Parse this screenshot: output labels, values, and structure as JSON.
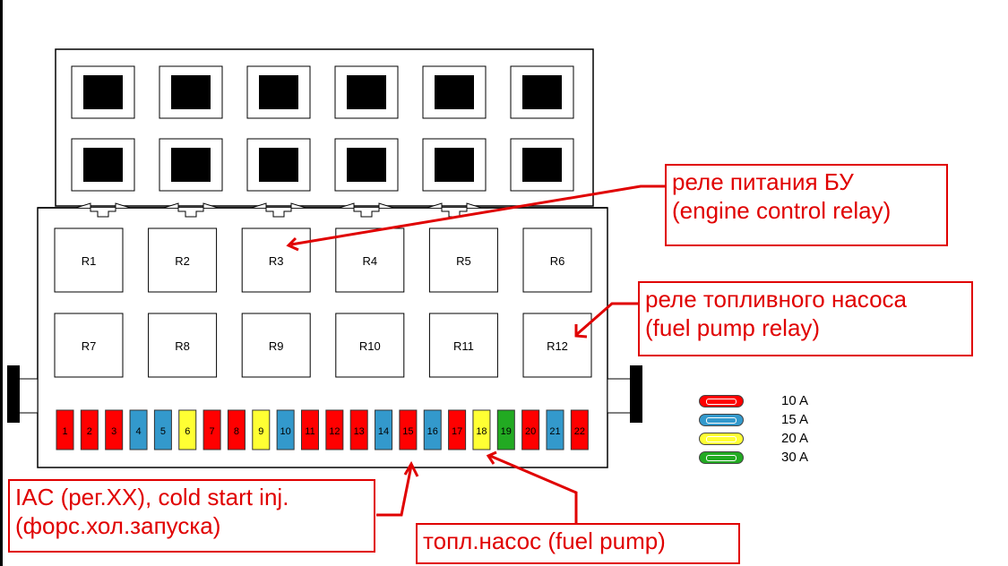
{
  "relays": [
    {
      "label": "R1"
    },
    {
      "label": "R2"
    },
    {
      "label": "R3"
    },
    {
      "label": "R4"
    },
    {
      "label": "R5"
    },
    {
      "label": "R6"
    },
    {
      "label": "R7"
    },
    {
      "label": "R8"
    },
    {
      "label": "R9"
    },
    {
      "label": "R10"
    },
    {
      "label": "R11"
    },
    {
      "label": "R12"
    }
  ],
  "fuses": [
    {
      "label": "1",
      "rating": "10 A"
    },
    {
      "label": "2",
      "rating": "10 A"
    },
    {
      "label": "3",
      "rating": "10 A"
    },
    {
      "label": "4",
      "rating": "15 A"
    },
    {
      "label": "5",
      "rating": "15 A"
    },
    {
      "label": "6",
      "rating": "20 A"
    },
    {
      "label": "7",
      "rating": "10 A"
    },
    {
      "label": "8",
      "rating": "10 A"
    },
    {
      "label": "9",
      "rating": "20 A"
    },
    {
      "label": "10",
      "rating": "15 A"
    },
    {
      "label": "11",
      "rating": "10 A"
    },
    {
      "label": "12",
      "rating": "10 A"
    },
    {
      "label": "13",
      "rating": "10 A"
    },
    {
      "label": "14",
      "rating": "15 A"
    },
    {
      "label": "15",
      "rating": "10 A"
    },
    {
      "label": "16",
      "rating": "15 A"
    },
    {
      "label": "17",
      "rating": "10 A"
    },
    {
      "label": "18",
      "rating": "20 A"
    },
    {
      "label": "19",
      "rating": "30 A"
    },
    {
      "label": "20",
      "rating": "10 A"
    },
    {
      "label": "21",
      "rating": "15 A"
    },
    {
      "label": "22",
      "rating": "10 A"
    }
  ],
  "legend": [
    {
      "label": "10 A",
      "color": "#ff0000"
    },
    {
      "label": "15 A",
      "color": "#3399cc"
    },
    {
      "label": "20 A",
      "color": "#ffff33"
    },
    {
      "label": "30 A",
      "color": "#22aa22"
    }
  ],
  "annotations": {
    "engine_relay": {
      "line1": "реле питания БУ",
      "line2": "(engine control relay)"
    },
    "fuel_pump_relay": {
      "line1": "реле топливного насоса",
      "line2": "(fuel pump relay)"
    },
    "iac": {
      "line1": "IAC (рег.XX), cold start inj.",
      "line2": "(форс.хол.запуска)"
    },
    "fuel_pump": {
      "line1": "топл.насос (fuel pump)"
    }
  },
  "colors": {
    "annotation": "#e00000",
    "fuse_10": "#ff0000",
    "fuse_15": "#3399cc",
    "fuse_20": "#ffff33",
    "fuse_30": "#22aa22"
  }
}
